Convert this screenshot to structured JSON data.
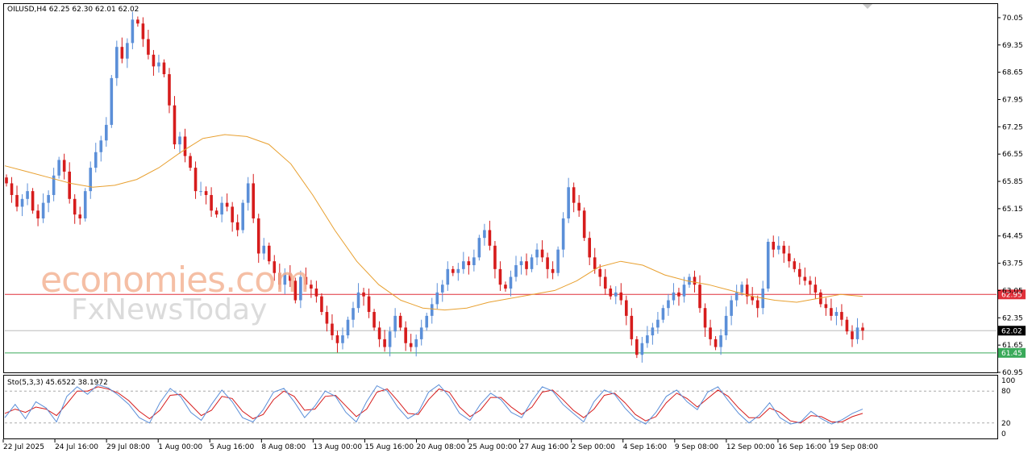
{
  "header": {
    "symbol": "OILUSD,H4",
    "ohlc": "62.25 62.30 62.01 62.02"
  },
  "indicator": {
    "label": "Sto(5,3,3)",
    "main_value": "45.6522",
    "signal_value": "38.1972",
    "levels": [
      100,
      80,
      20,
      0
    ]
  },
  "watermark": {
    "line1": "economies.com",
    "line2": "FxNewsToday"
  },
  "colors": {
    "bull": "#5b8fd8",
    "bear": "#d61c1c",
    "ma": "#e8a030",
    "stoch_main": "#5b8fd8",
    "stoch_signal": "#d61c1c",
    "resistance": "#e0303a",
    "support": "#3aaa5a",
    "current": "#000000"
  },
  "chart_data": {
    "type": "candlestick",
    "timeframe": "H4",
    "ylim": [
      60.95,
      70.4
    ],
    "y_ticks": [
      "70.05",
      "69.35",
      "68.65",
      "67.95",
      "67.25",
      "66.55",
      "65.85",
      "65.15",
      "64.45",
      "63.75",
      "63.05",
      "62.35",
      "61.65",
      "60.95"
    ],
    "x_labels": [
      "22 Jul 2025",
      "24 Jul 16:00",
      "29 Jul 08:00",
      "1 Aug 00:00",
      "5 Aug 16:00",
      "8 Aug 08:00",
      "13 Aug 00:00",
      "15 Aug 16:00",
      "20 Aug 08:00",
      "25 Aug 00:00",
      "27 Aug 16:00",
      "2 Sep 00:00",
      "4 Sep 16:00",
      "9 Sep 08:00",
      "12 Sep 00:00",
      "16 Sep 16:00",
      "19 Sep 08:00"
    ],
    "price_lines": [
      {
        "name": "resistance",
        "value": 62.95,
        "label": "62.95"
      },
      {
        "name": "current",
        "value": 62.02,
        "label": "62.02"
      },
      {
        "name": "support",
        "value": 61.45,
        "label": "61.45"
      }
    ],
    "close_path": [
      65.8,
      65.5,
      65.2,
      65.4,
      65.6,
      65.1,
      64.9,
      65.3,
      65.5,
      66.0,
      66.4,
      66.1,
      65.4,
      65.0,
      64.9,
      65.6,
      66.2,
      66.6,
      66.9,
      67.3,
      68.5,
      69.3,
      69.0,
      69.4,
      70.0,
      69.9,
      69.5,
      69.1,
      68.8,
      68.9,
      68.6,
      67.8,
      66.8,
      67.0,
      66.5,
      66.2,
      65.6,
      65.6,
      65.5,
      65.1,
      65.0,
      65.3,
      65.2,
      64.8,
      64.6,
      65.3,
      65.8,
      64.9,
      64.0,
      64.2,
      63.8,
      63.5,
      63.2,
      63.5,
      63.3,
      62.8,
      63.4,
      63.2,
      63.1,
      62.9,
      62.5,
      62.2,
      61.9,
      61.7,
      61.9,
      62.3,
      62.6,
      63.0,
      62.9,
      62.5,
      62.1,
      61.8,
      61.6,
      62.0,
      62.4,
      62.1,
      61.7,
      61.6,
      61.8,
      62.1,
      62.4,
      62.7,
      63.0,
      63.2,
      63.6,
      63.5,
      63.6,
      63.8,
      63.7,
      63.9,
      64.4,
      64.6,
      64.2,
      63.6,
      63.2,
      63.1,
      63.4,
      63.7,
      63.8,
      63.6,
      63.9,
      64.1,
      63.9,
      63.6,
      63.5,
      64.1,
      64.9,
      65.7,
      65.3,
      65.1,
      64.4,
      63.9,
      63.6,
      63.4,
      63.1,
      62.9,
      63.0,
      62.8,
      62.4,
      61.8,
      61.4,
      61.7,
      61.9,
      62.1,
      62.3,
      62.6,
      62.8,
      63.0,
      62.9,
      63.2,
      63.4,
      63.2,
      62.6,
      62.1,
      61.8,
      61.6,
      61.9,
      62.4,
      62.8,
      63.0,
      63.2,
      62.9,
      62.8,
      62.6,
      63.1,
      64.3,
      64.1,
      64.2,
      64.0,
      63.8,
      63.6,
      63.4,
      63.3,
      63.2,
      63.0,
      62.7,
      62.6,
      62.4,
      62.5,
      62.3,
      62.0,
      61.8,
      62.1,
      62.02
    ],
    "ma_path": [
      66.25,
      66.1,
      65.95,
      65.8,
      65.7,
      65.75,
      65.9,
      66.2,
      66.6,
      66.95,
      67.05,
      67.0,
      66.8,
      66.3,
      65.5,
      64.6,
      63.8,
      63.2,
      62.8,
      62.6,
      62.55,
      62.6,
      62.75,
      62.85,
      62.95,
      63.05,
      63.3,
      63.65,
      63.8,
      63.7,
      63.45,
      63.3,
      63.2,
      63.05,
      62.9,
      62.8,
      62.75,
      62.85,
      62.95,
      62.9
    ],
    "stoch_main": [
      30,
      55,
      28,
      60,
      48,
      22,
      70,
      88,
      74,
      92,
      86,
      72,
      55,
      30,
      20,
      58,
      85,
      70,
      40,
      25,
      55,
      82,
      60,
      30,
      22,
      45,
      78,
      85,
      60,
      30,
      52,
      80,
      70,
      40,
      22,
      60,
      90,
      80,
      50,
      28,
      40,
      78,
      92,
      70,
      38,
      25,
      55,
      76,
      64,
      40,
      30,
      62,
      88,
      80,
      55,
      38,
      22,
      60,
      82,
      74,
      48,
      28,
      18,
      40,
      70,
      82,
      60,
      45,
      78,
      88,
      62,
      38,
      20,
      35,
      58,
      30,
      18,
      22,
      42,
      28,
      18,
      26,
      38,
      46
    ],
    "stoch_signal": [
      38,
      46,
      40,
      50,
      46,
      34,
      56,
      80,
      80,
      88,
      84,
      76,
      62,
      42,
      28,
      44,
      72,
      74,
      54,
      34,
      44,
      70,
      66,
      42,
      28,
      36,
      64,
      80,
      70,
      44,
      46,
      70,
      72,
      52,
      32,
      46,
      78,
      84,
      62,
      38,
      36,
      64,
      84,
      78,
      50,
      32,
      44,
      68,
      68,
      50,
      36,
      50,
      78,
      82,
      64,
      44,
      30,
      46,
      72,
      76,
      58,
      36,
      24,
      32,
      58,
      76,
      66,
      50,
      66,
      82,
      70,
      48,
      30,
      30,
      48,
      40,
      24,
      20,
      34,
      32,
      22,
      22,
      32,
      38
    ]
  }
}
